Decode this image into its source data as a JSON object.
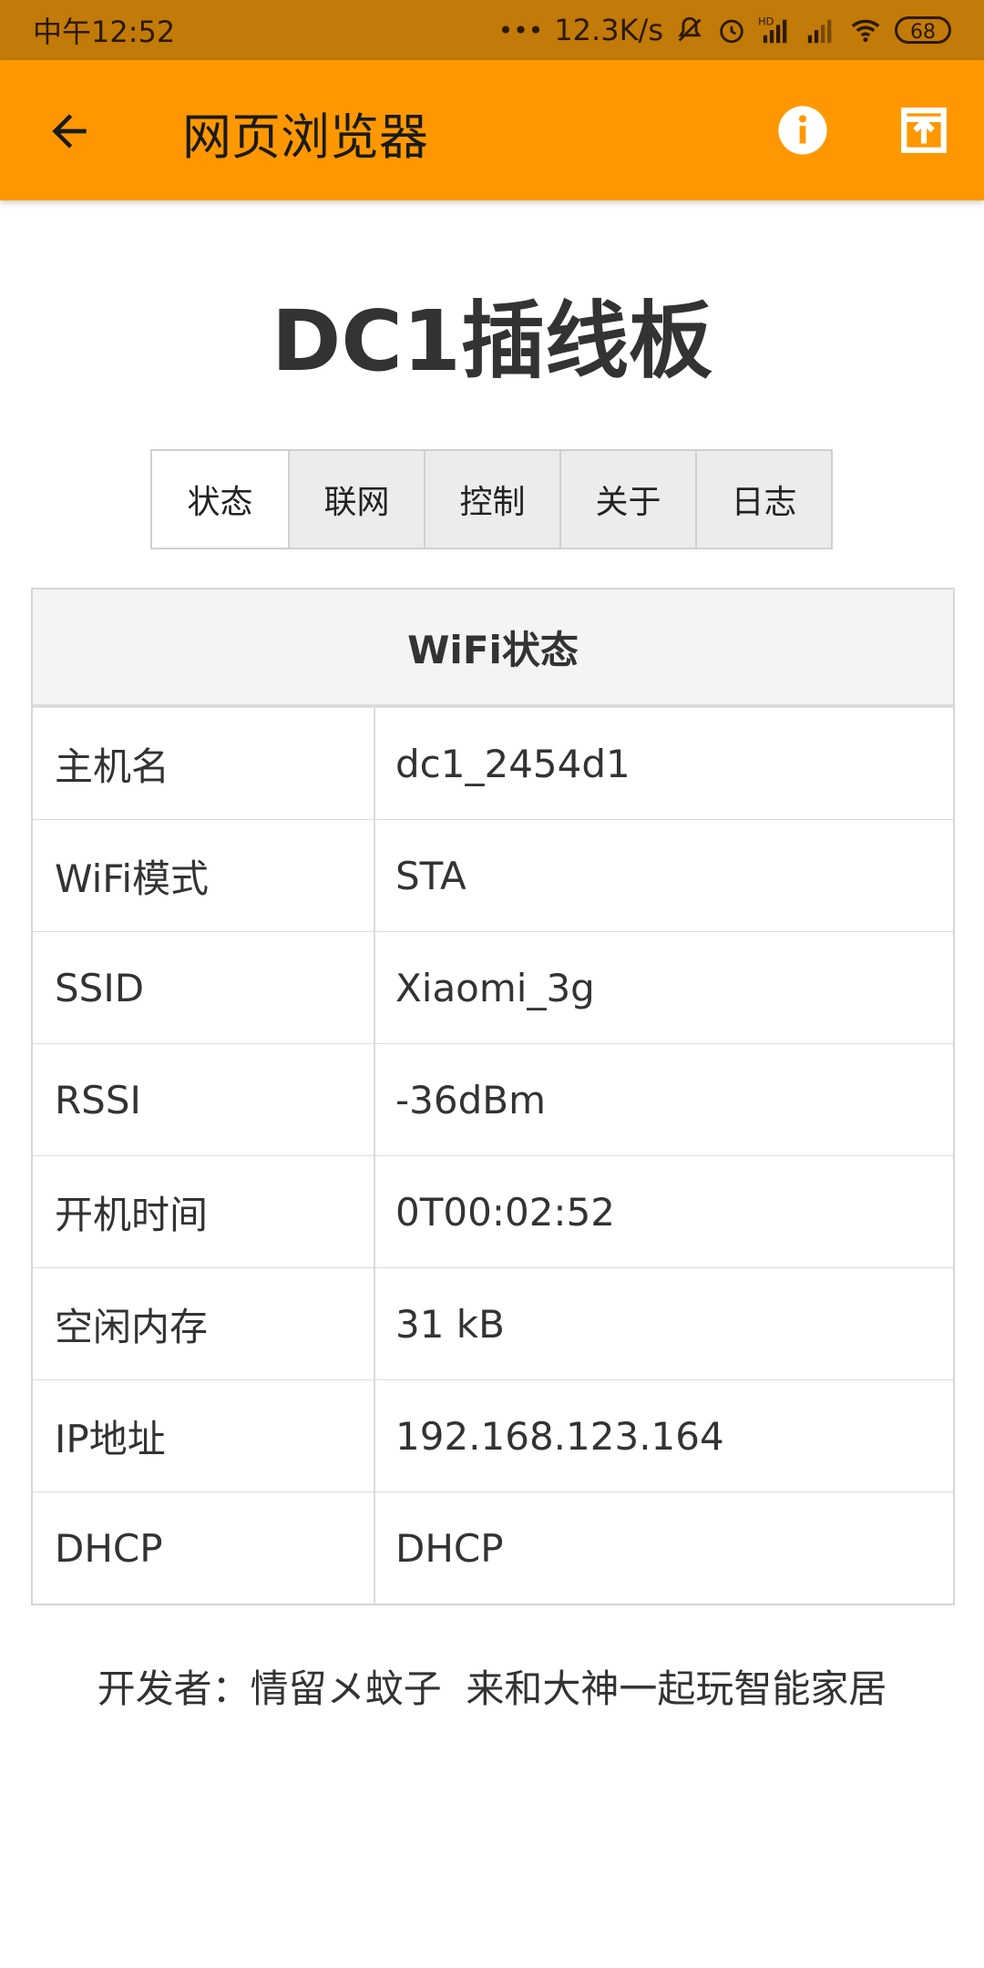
{
  "status_bar": {
    "time": "中午12:52",
    "net_speed": "12.3K/s",
    "battery": "68",
    "icons": [
      "dots-icon",
      "mute-icon",
      "alarm-icon",
      "signal-hd-icon",
      "signal-icon",
      "wifi-icon",
      "battery-icon"
    ]
  },
  "appbar": {
    "title": "网页浏览器",
    "icons": [
      "back-arrow-icon",
      "info-icon",
      "open-external-icon"
    ]
  },
  "page": {
    "title": "DC1插线板",
    "tabs": [
      "状态",
      "联网",
      "控制",
      "关于",
      "日志"
    ],
    "selected_tab": "状态"
  },
  "wifi_table": {
    "header": "WiFi状态",
    "rows": [
      {
        "key": "主机名",
        "value": "dc1_2454d1"
      },
      {
        "key": "WiFi模式",
        "value": "STA"
      },
      {
        "key": "SSID",
        "value": "Xiaomi_3g"
      },
      {
        "key": "RSSI",
        "value": "-36dBm"
      },
      {
        "key": "开机时间",
        "value": "0T00:02:52"
      },
      {
        "key": "空闲内存",
        "value": "31 kB"
      },
      {
        "key": "IP地址",
        "value": "192.168.123.164"
      },
      {
        "key": "DHCP",
        "value": "DHCP"
      }
    ]
  },
  "footer": "开发者：情留メ蚊子  来和大神一起玩智能家居",
  "colors": {
    "status_bar": "#c27a08",
    "app_bar": "#ff9800",
    "text": "#333333",
    "tab_inactive": "#ececec",
    "table_header": "#f4f4f4",
    "border": "#dcdcdc"
  }
}
